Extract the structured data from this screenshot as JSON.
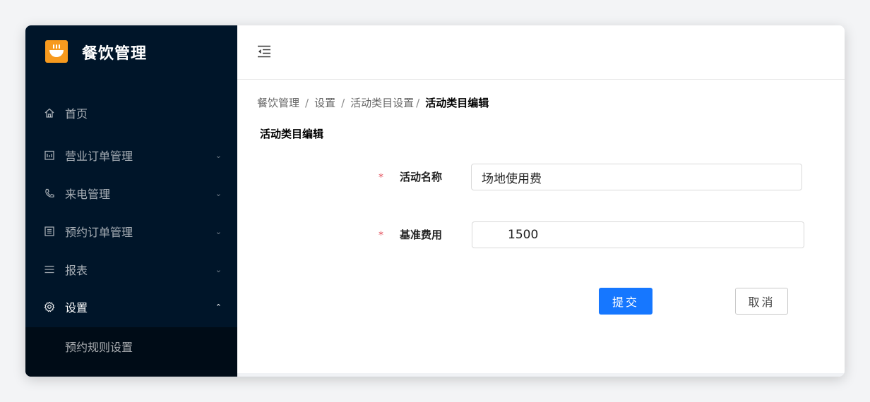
{
  "app": {
    "title": "餐饮管理"
  },
  "sidebar": {
    "items": [
      {
        "label": "首页",
        "icon": "home-icon"
      },
      {
        "label": "营业订单管理",
        "icon": "calendar-icon"
      },
      {
        "label": "来电管理",
        "icon": "phone-icon"
      },
      {
        "label": "预约订单管理",
        "icon": "list-icon"
      },
      {
        "label": "报表",
        "icon": "menu-lines-icon"
      },
      {
        "label": "设置",
        "icon": "gear-icon",
        "expanded": true
      }
    ],
    "submenu": [
      {
        "label": "预约规则设置"
      }
    ]
  },
  "breadcrumb": {
    "items": [
      "餐饮管理",
      "设置",
      "活动类目设置"
    ],
    "current": "活动类目编辑"
  },
  "page": {
    "title": "活动类目编辑"
  },
  "form": {
    "required_mark": "*",
    "name_label": "活动名称",
    "name_value": "场地使用费",
    "fee_label": "基准费用",
    "fee_value": "1500",
    "submit_label": "提交",
    "cancel_label": "取消"
  },
  "colors": {
    "sidebar_bg": "#001529",
    "primary": "#1677ff",
    "logo": "#f79a1e",
    "required": "#e34d59"
  }
}
